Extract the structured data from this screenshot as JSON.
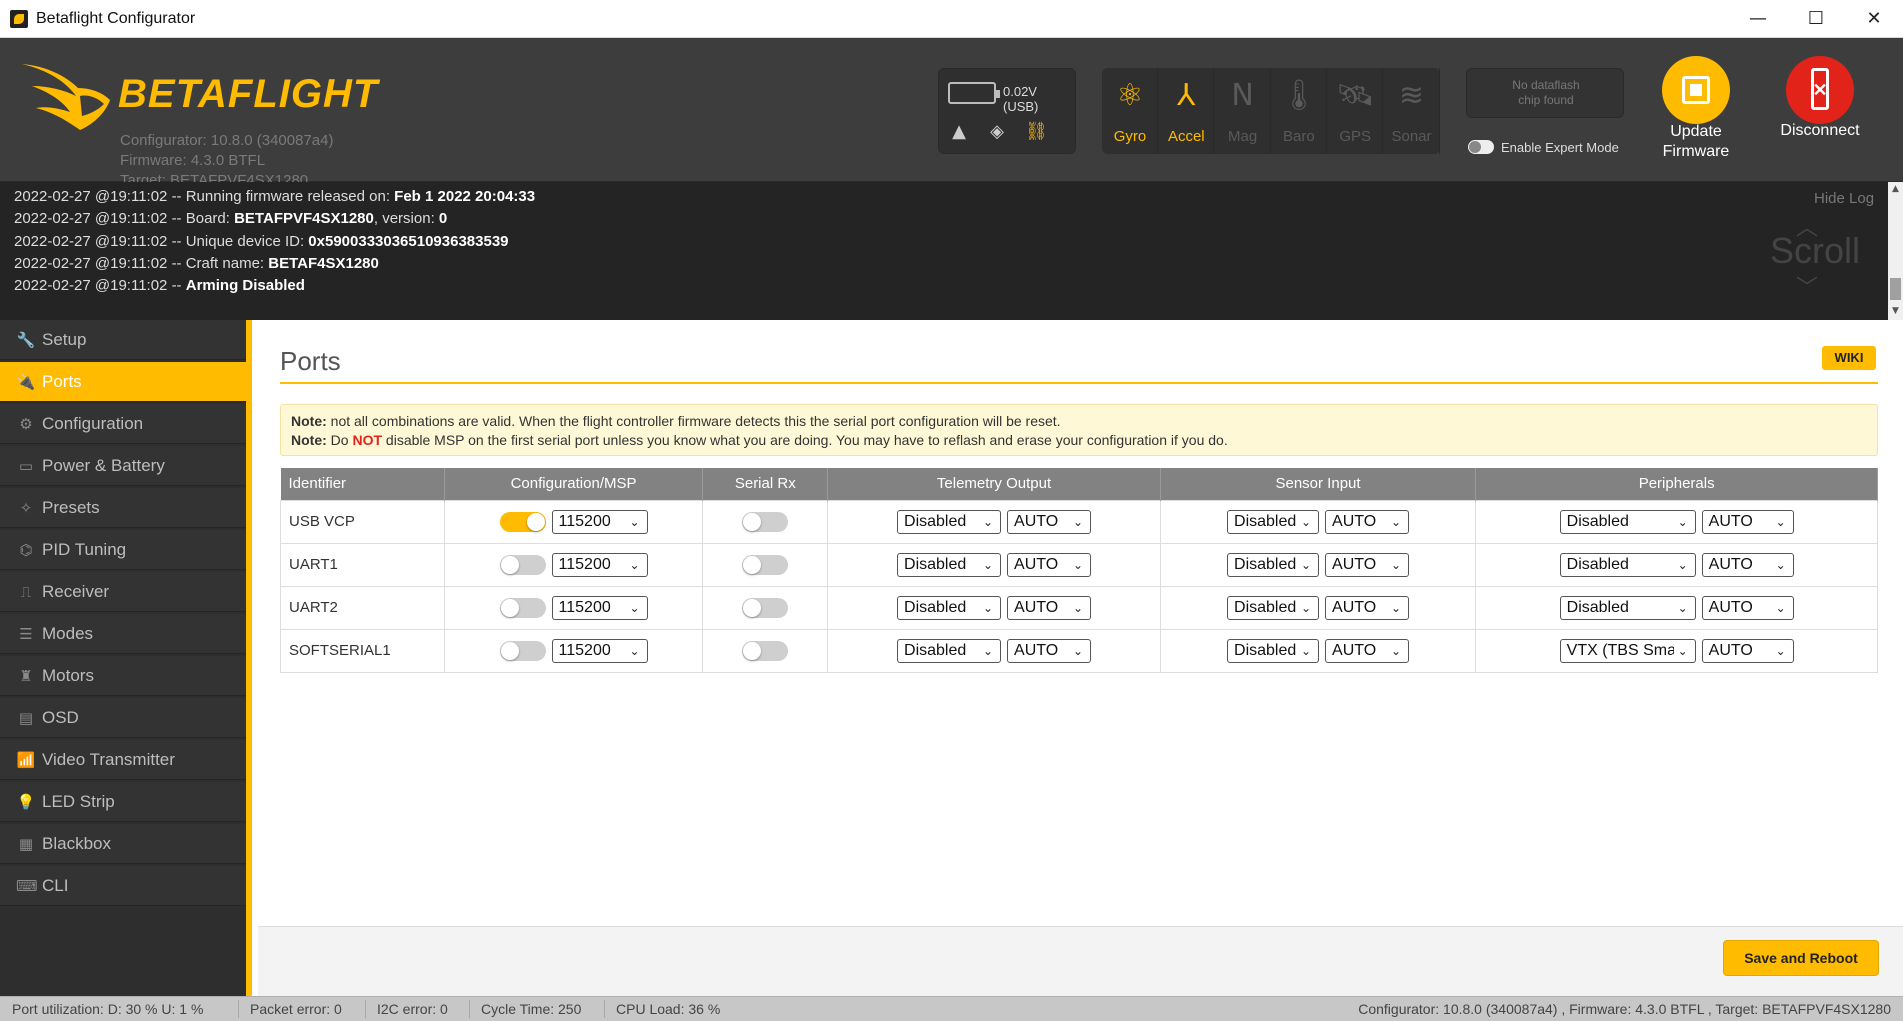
{
  "window": {
    "title": "Betaflight Configurator",
    "minimize_glyph": "—",
    "maximize_glyph": "☐",
    "close_glyph": "✕"
  },
  "header": {
    "logo_text": "BETAFLIGHT",
    "configurator_version": "Configurator: 10.8.0 (340087a4)",
    "firmware": "Firmware: 4.3.0 BTFL",
    "target": "Target: BETAFPVF4SX1280",
    "battery_text": "0.02V (USB)",
    "status_icons": [
      {
        "name": "warning-icon",
        "glyph": "▲",
        "color": "#cccccc"
      },
      {
        "name": "diamond-icon",
        "glyph": "◈",
        "color": "#cccccc"
      },
      {
        "name": "link-icon",
        "glyph": "⛓",
        "color": "#ffbb00"
      }
    ],
    "sensors": [
      {
        "label": "Gyro",
        "icon": "gyro-icon",
        "glyph": "⚛",
        "active": true
      },
      {
        "label": "Accel",
        "icon": "accel-icon",
        "glyph": "⅄",
        "active": true
      },
      {
        "label": "Mag",
        "icon": "mag-icon",
        "glyph": "N",
        "active": false
      },
      {
        "label": "Baro",
        "icon": "baro-icon",
        "glyph": "🌡",
        "active": false
      },
      {
        "label": "GPS",
        "icon": "gps-icon",
        "glyph": "🛰",
        "active": false
      },
      {
        "label": "Sonar",
        "icon": "sonar-icon",
        "glyph": "≋",
        "active": false
      }
    ],
    "dataflash_line1": "No dataflash",
    "dataflash_line2": "chip found",
    "expert_mode_label": "Enable Expert Mode",
    "expert_mode_on": false,
    "update_firmware_line1": "Update",
    "update_firmware_line2": "Firmware",
    "disconnect_label": "Disconnect",
    "accent_color": "#ffbb00",
    "disconnect_color": "#e2231a"
  },
  "log": {
    "hide_label": "Hide Log",
    "scroll_label": "Scroll",
    "lines": [
      {
        "prefix": "2022-02-27 @19:11:02 -- Running firmware released on: ",
        "value": "Feb 1 2022 20:04:33",
        "suffix": ""
      },
      {
        "prefix": "2022-02-27 @19:11:02 -- Board: ",
        "value": "BETAFPVF4SX1280",
        "suffix": ", version: ",
        "value2": "0"
      },
      {
        "prefix": "2022-02-27 @19:11:02 -- Unique device ID: ",
        "value": "0x590033303651093638353​9",
        "suffix": ""
      },
      {
        "prefix": "2022-02-27 @19:11:02 -- Craft name: ",
        "value": "BETAF4SX1280",
        "suffix": ""
      },
      {
        "prefix": "2022-02-27 @19:11:02 -- ",
        "value": "Arming Disabled",
        "suffix": ""
      }
    ]
  },
  "sidebar": {
    "items": [
      {
        "label": "Setup",
        "icon": "wrench-icon",
        "glyph": "🔧",
        "active": false
      },
      {
        "label": "Ports",
        "icon": "plug-icon",
        "glyph": "🔌",
        "active": true
      },
      {
        "label": "Configuration",
        "icon": "gear-icon",
        "glyph": "⚙",
        "active": false
      },
      {
        "label": "Power & Battery",
        "icon": "battery-icon",
        "glyph": "▭",
        "active": false
      },
      {
        "label": "Presets",
        "icon": "presets-icon",
        "glyph": "✧",
        "active": false
      },
      {
        "label": "PID Tuning",
        "icon": "pid-icon",
        "glyph": "⌬",
        "active": false
      },
      {
        "label": "Receiver",
        "icon": "receiver-icon",
        "glyph": "⎍",
        "active": false
      },
      {
        "label": "Modes",
        "icon": "modes-icon",
        "glyph": "☰",
        "active": false
      },
      {
        "label": "Motors",
        "icon": "motor-icon",
        "glyph": "♜",
        "active": false
      },
      {
        "label": "OSD",
        "icon": "osd-icon",
        "glyph": "▤",
        "active": false
      },
      {
        "label": "Video Transmitter",
        "icon": "antenna-icon",
        "glyph": "📶",
        "active": false
      },
      {
        "label": "LED Strip",
        "icon": "led-icon",
        "glyph": "💡",
        "active": false
      },
      {
        "label": "Blackbox",
        "icon": "blackbox-icon",
        "glyph": "▦",
        "active": false
      },
      {
        "label": "CLI",
        "icon": "terminal-icon",
        "glyph": "⌨",
        "active": false
      }
    ]
  },
  "main": {
    "title": "Ports",
    "wiki_label": "WIKI",
    "note1_bold": "Note:",
    "note1_text": " not all combinations are valid. When the flight controller firmware detects this the serial port configuration will be reset.",
    "note2_bold": "Note:",
    "note2_pre": " Do ",
    "note2_red": "NOT",
    "note2_post": " disable MSP on the first serial port unless you know what you are doing. You may have to reflash and erase your configuration if you do.",
    "columns": [
      "Identifier",
      "Configuration/MSP",
      "Serial Rx",
      "Telemetry Output",
      "Sensor Input",
      "Peripherals"
    ],
    "rows": [
      {
        "id": "USB VCP",
        "msp_on": true,
        "msp_baud": "115200",
        "rx_on": false,
        "telem": "Disabled",
        "telem_baud": "AUTO",
        "sensor": "Disabled",
        "sensor_baud": "AUTO",
        "periph": "Disabled",
        "periph_baud": "AUTO"
      },
      {
        "id": "UART1",
        "msp_on": false,
        "msp_baud": "115200",
        "rx_on": false,
        "telem": "Disabled",
        "telem_baud": "AUTO",
        "sensor": "Disabled",
        "sensor_baud": "AUTO",
        "periph": "Disabled",
        "periph_baud": "AUTO"
      },
      {
        "id": "UART2",
        "msp_on": false,
        "msp_baud": "115200",
        "rx_on": false,
        "telem": "Disabled",
        "telem_baud": "AUTO",
        "sensor": "Disabled",
        "sensor_baud": "AUTO",
        "periph": "Disabled",
        "periph_baud": "AUTO"
      },
      {
        "id": "SOFTSERIAL1",
        "msp_on": false,
        "msp_baud": "115200",
        "rx_on": false,
        "telem": "Disabled",
        "telem_baud": "AUTO",
        "sensor": "Disabled",
        "sensor_baud": "AUTO",
        "periph": "VTX (TBS Sma",
        "periph_baud": "AUTO"
      }
    ],
    "save_label": "Save and Reboot"
  },
  "statusbar": {
    "port_util": "Port utilization: D: 30 % U: 1 %",
    "packet_error": "Packet error: 0",
    "i2c_error": "I2C error: 0",
    "cycle_time": "Cycle Time: 250",
    "cpu_load": "CPU Load: 36 %",
    "version_info": "Configurator: 10.8.0 (340087a4) , Firmware: 4.3.0 BTFL , Target: BETAFPVF4SX1280"
  }
}
